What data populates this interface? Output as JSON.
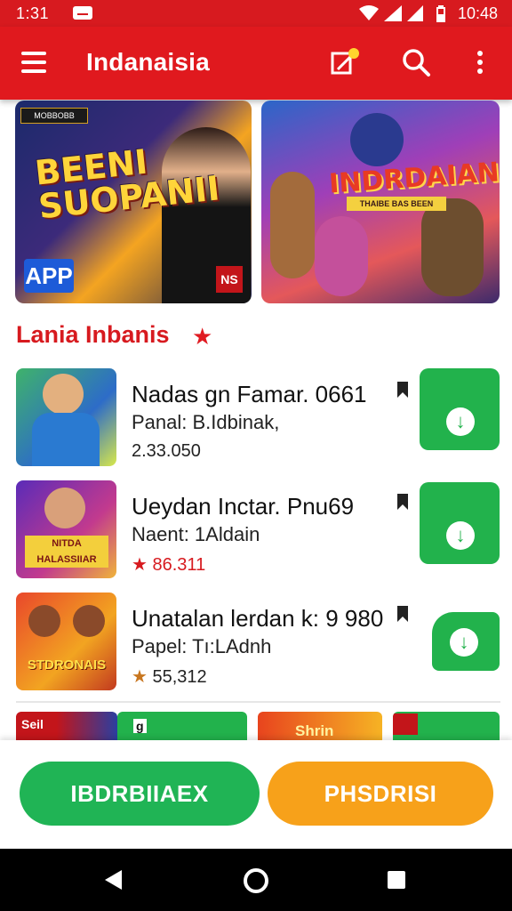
{
  "status_bar": {
    "time": "1:31",
    "clock": "10:48",
    "icons": [
      "message-icon",
      "wifi-icon",
      "signal-icon",
      "battery-icon"
    ]
  },
  "app_bar": {
    "title": "Indanaisia",
    "icons": [
      "menu-icon",
      "edit-badge-icon",
      "search-icon",
      "more-vert-icon"
    ]
  },
  "banners": [
    {
      "badge": "MOBBOBB",
      "title_line1": "BEENI",
      "title_line2": "SUOPANII",
      "tag": "APP",
      "logo": "NS"
    },
    {
      "title": "INDRDAIAN",
      "subtitle": "THAIBE BAS BEEN"
    }
  ],
  "section": {
    "title": "Lania Inbanis",
    "icon": "star-icon"
  },
  "list": [
    {
      "title": "Nadas gn Famar. 0661",
      "subtitle": "Panal: B.Idbinak,",
      "count": "2.33.050",
      "action_icon": "download-icon"
    },
    {
      "title": "Ueydan  Inctar. Pnu69",
      "subtitle": "Naent: 1Aldain",
      "count": "86.311",
      "action_icon": "download-icon"
    },
    {
      "title": "Unatalan lerdan k: 9 980",
      "subtitle": "Papel: Tı:LAdnh",
      "count": "55,312",
      "action_icon": "download-icon"
    }
  ],
  "thumb_labels": {
    "second": "NITDA HALASSIIAR",
    "third": "STDRONAIS"
  },
  "strip_cards": [
    "Seil",
    "g",
    "Shrin",
    ""
  ],
  "buttons": {
    "primary": "IBDRBIIAEX",
    "secondary": "PHSDRISI"
  },
  "colors": {
    "brand_red": "#e0191e",
    "download_green": "#22b24c",
    "primary_green": "#20b455",
    "secondary_orange": "#f7a11a"
  }
}
